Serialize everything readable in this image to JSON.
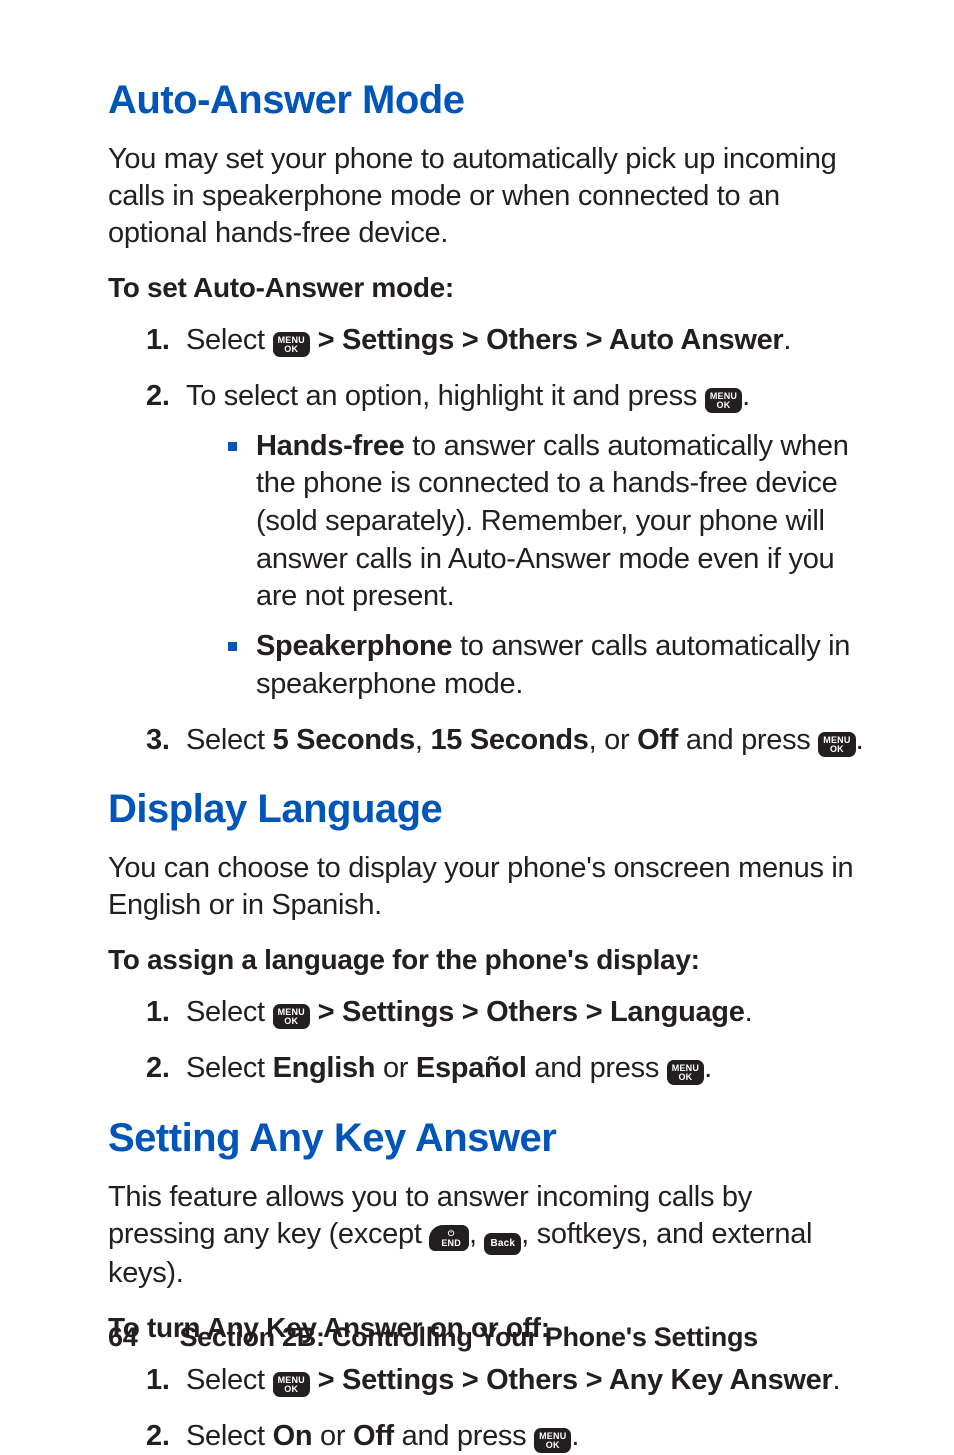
{
  "sections": [
    {
      "heading": "Auto-Answer Mode",
      "intro": "You may set your phone to automatically pick up incoming calls in speakerphone mode or when connected to an optional hands-free device.",
      "subhead": "To set Auto-Answer mode:",
      "step1_pre": "Select ",
      "step1_post": " > Settings > Others > Auto Answer",
      "step2_pre": "To select an option, highlight it and press ",
      "bullet1_lead": "Hands-free",
      "bullet1_rest": " to answer calls automatically when the phone is connected to a hands-free device (sold separately). Remember, your phone will answer calls in Auto-Answer mode even if you are not present.",
      "bullet2_lead": "Speakerphone",
      "bullet2_rest": " to answer calls automatically in speakerphone mode.",
      "step3_a": "Select ",
      "step3_b": "5 Seconds",
      "step3_c": ", ",
      "step3_d": "15 Seconds",
      "step3_e": ", or ",
      "step3_f": "Off",
      "step3_g": " and press "
    },
    {
      "heading": "Display Language",
      "intro": "You can choose to display your phone's onscreen menus in English or in Spanish.",
      "subhead": "To assign a language for the phone's display:",
      "step1_pre": "Select ",
      "step1_post": " > Settings > Others > Language",
      "step2_a": "Select ",
      "step2_b": "English",
      "step2_c": " or ",
      "step2_d": "Español",
      "step2_e": " and press "
    },
    {
      "heading": "Setting Any Key Answer",
      "intro_a": "This feature allows you to answer incoming calls by pressing any key (except ",
      "intro_b": ", ",
      "intro_c": ", softkeys, and external keys).",
      "subhead": "To turn Any Key Answer on or off:",
      "step1_pre": "Select ",
      "step1_post": " > Settings > Others > Any Key Answer",
      "step2_a": "Select ",
      "step2_b": "On",
      "step2_c": " or ",
      "step2_d": "Off",
      "step2_e": " and press "
    }
  ],
  "keys": {
    "menu_top": "MENU",
    "menu_bot": "OK",
    "end_pwr": "⏻",
    "end_lbl": "END",
    "back": "Back"
  },
  "footer": {
    "page": "64",
    "title": "Section 2B: Controlling Your Phone's Settings"
  }
}
